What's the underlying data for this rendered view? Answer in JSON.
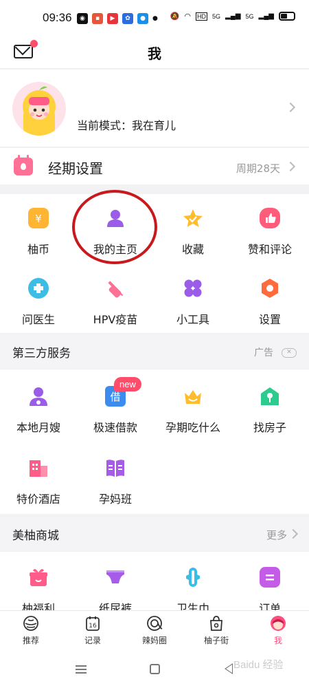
{
  "status_bar": {
    "time": "09:36",
    "network_labels": [
      "HD",
      "5G",
      "5G"
    ]
  },
  "header": {
    "title": "我"
  },
  "profile": {
    "mode_text": "当前模式：我在育儿"
  },
  "period": {
    "label": "经期设置",
    "value": "周期28天"
  },
  "menu_grid": [
    {
      "label": "柚币",
      "icon": "coin-icon",
      "color": "#ffb534"
    },
    {
      "label": "我的主页",
      "icon": "user-icon",
      "color": "#9b5ce8"
    },
    {
      "label": "收藏",
      "icon": "star-icon",
      "color": "#ffbd2e"
    },
    {
      "label": "赞和评论",
      "icon": "like-comment-icon",
      "color": "#ff5c7c"
    },
    {
      "label": "问医生",
      "icon": "medical-icon",
      "color": "#3cbde6"
    },
    {
      "label": "HPV疫苗",
      "icon": "syringe-icon",
      "color": "#ff6f96"
    },
    {
      "label": "小工具",
      "icon": "tools-icon",
      "color": "#9b5ce8"
    },
    {
      "label": "设置",
      "icon": "settings-icon",
      "color": "#ff6b3d"
    }
  ],
  "third_party": {
    "title": "第三方服务",
    "ad_label": "广告",
    "items": [
      {
        "label": "本地月嫂",
        "icon": "nanny-icon",
        "color": "#9b5ce8"
      },
      {
        "label": "极速借款",
        "icon": "loan-icon",
        "color": "#3c8cf0",
        "badge": "new"
      },
      {
        "label": "孕期吃什么",
        "icon": "crown-food-icon",
        "color": "#ffbd2e"
      },
      {
        "label": "找房子",
        "icon": "house-icon",
        "color": "#2ecb8f"
      },
      {
        "label": "特价酒店",
        "icon": "hotel-icon",
        "color": "#ff5c8a"
      },
      {
        "label": "孕妈班",
        "icon": "book-icon",
        "color": "#a65ce8"
      }
    ]
  },
  "mall": {
    "title": "美柚商城",
    "more_label": "更多",
    "items": [
      {
        "label": "柚福利",
        "icon": "gift-icon",
        "color": "#ff5c8a"
      },
      {
        "label": "纸尿裤",
        "icon": "diaper-icon",
        "color": "#a65ce8"
      },
      {
        "label": "卫生巾",
        "icon": "pad-icon",
        "color": "#3cbde6"
      },
      {
        "label": "订单",
        "icon": "order-icon",
        "color": "#c45ce8"
      }
    ]
  },
  "tabbar": [
    {
      "label": "推荐",
      "icon": "recommend-icon",
      "active": false
    },
    {
      "label": "记录",
      "icon": "calendar-icon",
      "date": "16",
      "active": false
    },
    {
      "label": "辣妈圈",
      "icon": "circle-icon",
      "active": false
    },
    {
      "label": "柚子街",
      "icon": "shopping-bag-icon",
      "active": false
    },
    {
      "label": "我",
      "icon": "me-icon",
      "active": true
    }
  ],
  "colors": {
    "accent": "#ff4d7d",
    "highlight_circle": "#c8191e"
  },
  "watermark": "Baidu 经验"
}
